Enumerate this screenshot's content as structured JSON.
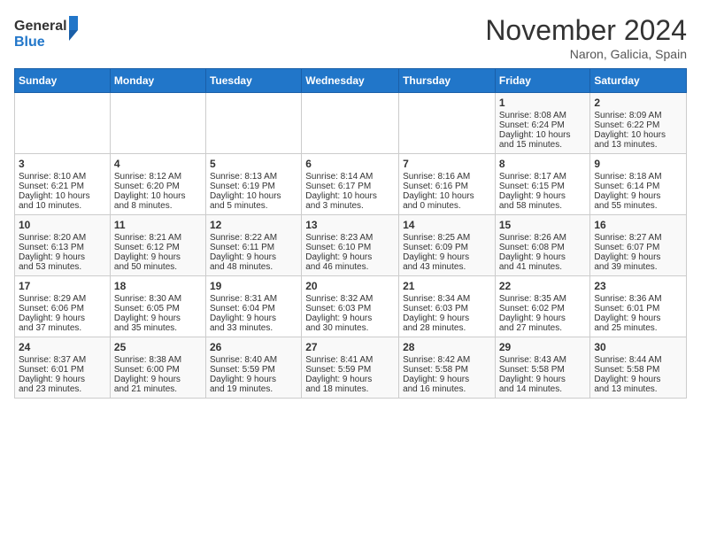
{
  "header": {
    "logo_general": "General",
    "logo_blue": "Blue",
    "title": "November 2024",
    "location": "Naron, Galicia, Spain"
  },
  "days_of_week": [
    "Sunday",
    "Monday",
    "Tuesday",
    "Wednesday",
    "Thursday",
    "Friday",
    "Saturday"
  ],
  "weeks": [
    [
      {
        "day": "",
        "info": ""
      },
      {
        "day": "",
        "info": ""
      },
      {
        "day": "",
        "info": ""
      },
      {
        "day": "",
        "info": ""
      },
      {
        "day": "",
        "info": ""
      },
      {
        "day": "1",
        "info": "Sunrise: 8:08 AM\nSunset: 6:24 PM\nDaylight: 10 hours and 15 minutes."
      },
      {
        "day": "2",
        "info": "Sunrise: 8:09 AM\nSunset: 6:22 PM\nDaylight: 10 hours and 13 minutes."
      }
    ],
    [
      {
        "day": "3",
        "info": "Sunrise: 8:10 AM\nSunset: 6:21 PM\nDaylight: 10 hours and 10 minutes."
      },
      {
        "day": "4",
        "info": "Sunrise: 8:12 AM\nSunset: 6:20 PM\nDaylight: 10 hours and 8 minutes."
      },
      {
        "day": "5",
        "info": "Sunrise: 8:13 AM\nSunset: 6:19 PM\nDaylight: 10 hours and 5 minutes."
      },
      {
        "day": "6",
        "info": "Sunrise: 8:14 AM\nSunset: 6:17 PM\nDaylight: 10 hours and 3 minutes."
      },
      {
        "day": "7",
        "info": "Sunrise: 8:16 AM\nSunset: 6:16 PM\nDaylight: 10 hours and 0 minutes."
      },
      {
        "day": "8",
        "info": "Sunrise: 8:17 AM\nSunset: 6:15 PM\nDaylight: 9 hours and 58 minutes."
      },
      {
        "day": "9",
        "info": "Sunrise: 8:18 AM\nSunset: 6:14 PM\nDaylight: 9 hours and 55 minutes."
      }
    ],
    [
      {
        "day": "10",
        "info": "Sunrise: 8:20 AM\nSunset: 6:13 PM\nDaylight: 9 hours and 53 minutes."
      },
      {
        "day": "11",
        "info": "Sunrise: 8:21 AM\nSunset: 6:12 PM\nDaylight: 9 hours and 50 minutes."
      },
      {
        "day": "12",
        "info": "Sunrise: 8:22 AM\nSunset: 6:11 PM\nDaylight: 9 hours and 48 minutes."
      },
      {
        "day": "13",
        "info": "Sunrise: 8:23 AM\nSunset: 6:10 PM\nDaylight: 9 hours and 46 minutes."
      },
      {
        "day": "14",
        "info": "Sunrise: 8:25 AM\nSunset: 6:09 PM\nDaylight: 9 hours and 43 minutes."
      },
      {
        "day": "15",
        "info": "Sunrise: 8:26 AM\nSunset: 6:08 PM\nDaylight: 9 hours and 41 minutes."
      },
      {
        "day": "16",
        "info": "Sunrise: 8:27 AM\nSunset: 6:07 PM\nDaylight: 9 hours and 39 minutes."
      }
    ],
    [
      {
        "day": "17",
        "info": "Sunrise: 8:29 AM\nSunset: 6:06 PM\nDaylight: 9 hours and 37 minutes."
      },
      {
        "day": "18",
        "info": "Sunrise: 8:30 AM\nSunset: 6:05 PM\nDaylight: 9 hours and 35 minutes."
      },
      {
        "day": "19",
        "info": "Sunrise: 8:31 AM\nSunset: 6:04 PM\nDaylight: 9 hours and 33 minutes."
      },
      {
        "day": "20",
        "info": "Sunrise: 8:32 AM\nSunset: 6:03 PM\nDaylight: 9 hours and 30 minutes."
      },
      {
        "day": "21",
        "info": "Sunrise: 8:34 AM\nSunset: 6:03 PM\nDaylight: 9 hours and 28 minutes."
      },
      {
        "day": "22",
        "info": "Sunrise: 8:35 AM\nSunset: 6:02 PM\nDaylight: 9 hours and 27 minutes."
      },
      {
        "day": "23",
        "info": "Sunrise: 8:36 AM\nSunset: 6:01 PM\nDaylight: 9 hours and 25 minutes."
      }
    ],
    [
      {
        "day": "24",
        "info": "Sunrise: 8:37 AM\nSunset: 6:01 PM\nDaylight: 9 hours and 23 minutes."
      },
      {
        "day": "25",
        "info": "Sunrise: 8:38 AM\nSunset: 6:00 PM\nDaylight: 9 hours and 21 minutes."
      },
      {
        "day": "26",
        "info": "Sunrise: 8:40 AM\nSunset: 5:59 PM\nDaylight: 9 hours and 19 minutes."
      },
      {
        "day": "27",
        "info": "Sunrise: 8:41 AM\nSunset: 5:59 PM\nDaylight: 9 hours and 18 minutes."
      },
      {
        "day": "28",
        "info": "Sunrise: 8:42 AM\nSunset: 5:58 PM\nDaylight: 9 hours and 16 minutes."
      },
      {
        "day": "29",
        "info": "Sunrise: 8:43 AM\nSunset: 5:58 PM\nDaylight: 9 hours and 14 minutes."
      },
      {
        "day": "30",
        "info": "Sunrise: 8:44 AM\nSunset: 5:58 PM\nDaylight: 9 hours and 13 minutes."
      }
    ]
  ]
}
